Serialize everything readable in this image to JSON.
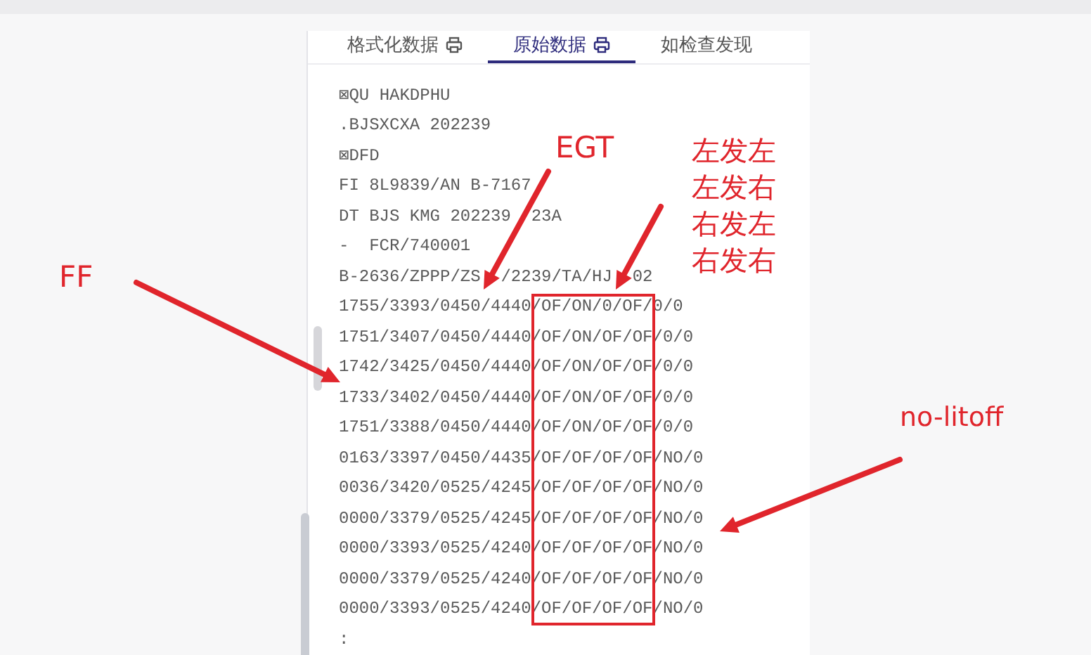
{
  "tabs": [
    {
      "label": "格式化数据",
      "selected": false,
      "print_icon": true
    },
    {
      "label": "原始数据",
      "selected": true,
      "print_icon": true
    },
    {
      "label": "如检查发现",
      "selected": false,
      "print_icon": false
    }
  ],
  "message_lines": [
    {
      "parts": [
        "⊠QU HAKDPHU"
      ]
    },
    {
      "parts": [
        ".BJSXCXA 202239"
      ]
    },
    {
      "parts": [
        "⊠DFD"
      ]
    },
    {
      "parts": [
        "FI 8L9839/AN B-7167"
      ]
    },
    {
      "parts": [
        "DT BJS KMG 202239",
        "23A"
      ]
    },
    {
      "parts": [
        "-  FCR/740001"
      ]
    },
    {
      "parts": [
        "B-2636/ZPPP/ZS",
        "/2239/TA/HJ",
        "02"
      ]
    },
    {
      "parts": [
        "1755/3393/0450/4440/OF/ON/0/OF/0/0"
      ]
    },
    {
      "parts": [
        "1751/3407/0450/4440/OF/ON/OF/OF/0/0"
      ]
    },
    {
      "parts": [
        "1742/3425/0450/4440/OF/ON/OF/OF/0/0"
      ]
    },
    {
      "parts": [
        "1733/3402/0450/4440/OF/ON/OF/OF/0/0"
      ]
    },
    {
      "parts": [
        "1751/3388/0450/4440/OF/ON/OF/OF/0/0"
      ]
    },
    {
      "parts": [
        "0163/3397/0450/4435/OF/OF/OF/OF/NO/0"
      ]
    },
    {
      "parts": [
        "0036/3420/0525/4245/OF/OF/OF/OF/NO/0"
      ]
    },
    {
      "parts": [
        "0000/3379/0525/4245/OF/OF/OF/OF/NO/0"
      ]
    },
    {
      "parts": [
        "0000/3393/0525/4240/OF/OF/OF/OF/NO/0"
      ]
    },
    {
      "parts": [
        "0000/3379/0525/4240/OF/OF/OF/OF/NO/0"
      ]
    },
    {
      "parts": [
        "0000/3393/0525/4240/OF/OF/OF/OF/NO/0"
      ]
    },
    {
      "parts": [
        ":"
      ]
    }
  ],
  "annotations": [
    {
      "kind": "label",
      "text": "EGT"
    },
    {
      "kind": "stack",
      "lines": [
        "左发左",
        "左发右",
        "右发左",
        "右发右"
      ]
    },
    {
      "kind": "label",
      "text": "FF"
    },
    {
      "kind": "label",
      "text": "no-litoff"
    }
  ]
}
